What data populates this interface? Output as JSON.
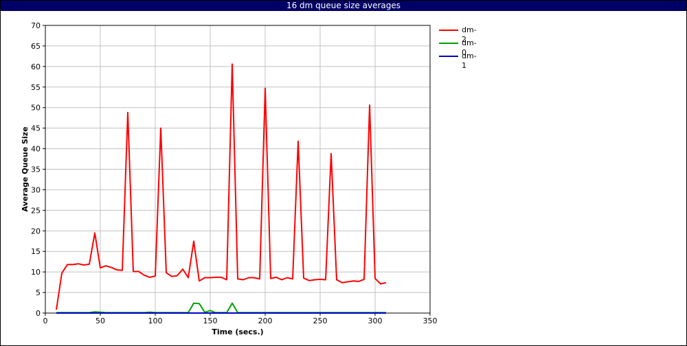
{
  "chart_data": {
    "type": "line",
    "title": "16 dm queue size averages",
    "xlabel": "Time (secs.)",
    "ylabel": "Average Queue Size",
    "xlim": [
      0,
      350
    ],
    "ylim": [
      0,
      70
    ],
    "xticks": [
      0,
      50,
      100,
      150,
      200,
      250,
      300,
      350
    ],
    "yticks": [
      0,
      5,
      10,
      15,
      20,
      25,
      30,
      35,
      40,
      45,
      50,
      55,
      60,
      65,
      70
    ],
    "grid": true,
    "legend_position": "right",
    "background": "#ffffff",
    "title_bar_color": "#000066",
    "grid_color": "#c0c0c0",
    "series": [
      {
        "name": "dm-2",
        "color": "#ff0000",
        "x": [
          10,
          15,
          20,
          25,
          30,
          35,
          40,
          45,
          50,
          55,
          60,
          65,
          70,
          75,
          80,
          85,
          90,
          95,
          100,
          105,
          110,
          115,
          120,
          125,
          130,
          135,
          140,
          145,
          150,
          155,
          160,
          165,
          170,
          175,
          180,
          185,
          190,
          195,
          200,
          205,
          210,
          215,
          220,
          225,
          230,
          235,
          240,
          245,
          250,
          255,
          260,
          265,
          270,
          275,
          280,
          285,
          290,
          295,
          300,
          305,
          310
        ],
        "y": [
          0.8,
          9.7,
          11.8,
          11.8,
          12.0,
          11.7,
          11.9,
          19.5,
          11.0,
          11.5,
          11.1,
          10.5,
          10.4,
          48.8,
          10.1,
          10.1,
          9.2,
          8.7,
          9.0,
          45.0,
          9.8,
          8.9,
          9.1,
          10.7,
          8.6,
          17.5,
          7.8,
          8.6,
          8.6,
          8.7,
          8.7,
          8.1,
          60.6,
          8.3,
          8.1,
          8.6,
          8.6,
          8.3,
          54.7,
          8.4,
          8.7,
          8.1,
          8.6,
          8.3,
          41.8,
          8.5,
          7.9,
          8.1,
          8.2,
          8.1,
          38.8,
          8.1,
          7.4,
          7.6,
          7.8,
          7.7,
          8.2,
          50.6,
          8.4,
          7.1,
          7.4
        ]
      },
      {
        "name": "dm-0",
        "color": "#00a000",
        "x": [
          10,
          15,
          20,
          25,
          30,
          35,
          40,
          45,
          50,
          55,
          60,
          65,
          70,
          75,
          80,
          85,
          90,
          95,
          100,
          105,
          110,
          115,
          120,
          125,
          130,
          135,
          140,
          145,
          150,
          155,
          160,
          165,
          170,
          175,
          180,
          185,
          190,
          195,
          200,
          205,
          210,
          215,
          220,
          225,
          230,
          235,
          240,
          245,
          250,
          255,
          260,
          265,
          270,
          275,
          280,
          285,
          290,
          295,
          300,
          305,
          310
        ],
        "y": [
          0.1,
          0.1,
          0.1,
          0.1,
          0.1,
          0.1,
          0.1,
          0.3,
          0.2,
          0.1,
          0.1,
          0.1,
          0.1,
          0.1,
          0.1,
          0.1,
          0.1,
          0.2,
          0.1,
          0.1,
          0.1,
          0.1,
          0.1,
          0.1,
          0.1,
          2.4,
          2.3,
          0.2,
          0.6,
          0.1,
          0.1,
          0.1,
          2.4,
          0.1,
          0.1,
          0.1,
          0.1,
          0.1,
          0.1,
          0.1,
          0.1,
          0.1,
          0.1,
          0.1,
          0.1,
          0.1,
          0.1,
          0.1,
          0.1,
          0.1,
          0.1,
          0.1,
          0.1,
          0.1,
          0.1,
          0.1,
          0.1,
          0.1,
          0.1,
          0.1,
          0.1
        ]
      },
      {
        "name": "dm-1",
        "color": "#0000cc",
        "x": [
          10,
          50,
          100,
          140,
          145,
          150,
          155,
          165,
          170,
          175,
          200,
          250,
          300,
          310
        ],
        "y": [
          0,
          0,
          0,
          0,
          0,
          0,
          0,
          0,
          0,
          0,
          0,
          0,
          0,
          0
        ]
      }
    ]
  }
}
